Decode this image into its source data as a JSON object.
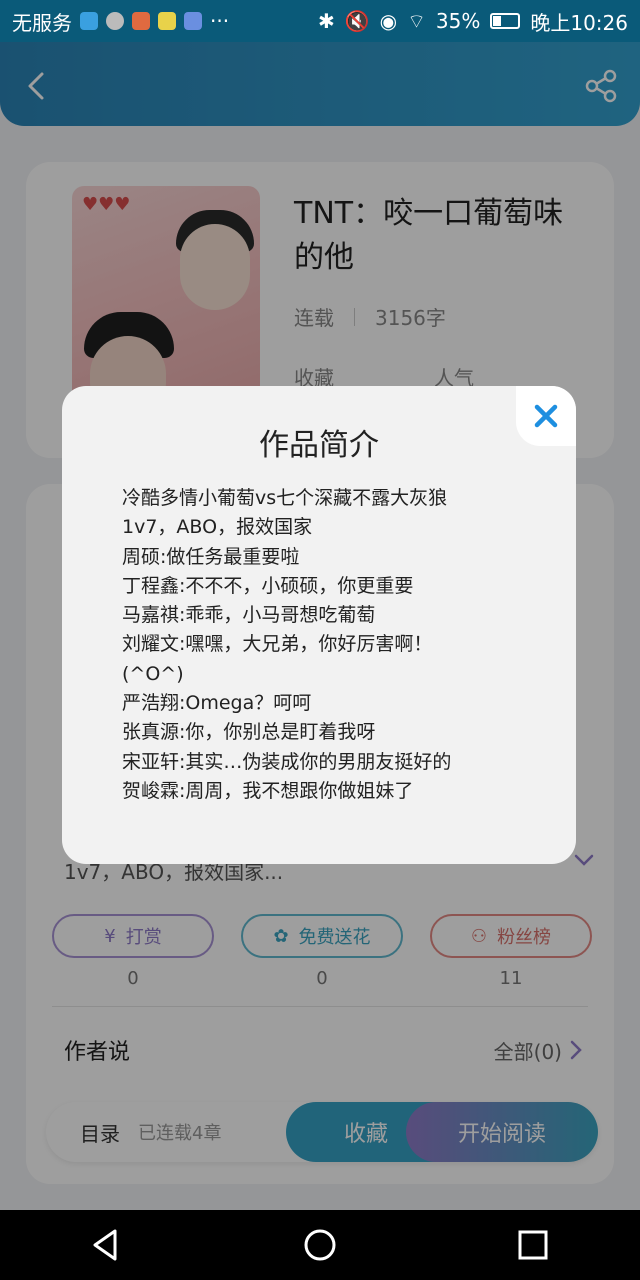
{
  "status_bar": {
    "carrier": "无服务",
    "battery": "35%",
    "battery_level": 0.35,
    "time": "晚上10:26"
  },
  "book": {
    "title": "TNT：咬一口葡萄味的他",
    "status": "连载",
    "word_count": "3156字",
    "collect_label": "收藏",
    "popularity_label": "人气"
  },
  "detail": {
    "intro_preview": "1v7，ABO，报效国家...",
    "actions": [
      {
        "label": "打赏",
        "icon": "coin-icon",
        "count": "0"
      },
      {
        "label": "免费送花",
        "icon": "flower-icon",
        "count": "0"
      },
      {
        "label": "粉丝榜",
        "icon": "user-icon",
        "count": "11"
      }
    ],
    "author_section": {
      "title": "作者说",
      "all_label": "全部(0)"
    }
  },
  "bottom_bar": {
    "toc_label": "目录",
    "toc_count": "已连载4章",
    "collect_button": "收藏",
    "read_button": "开始阅读"
  },
  "modal": {
    "title": "作品简介",
    "lines": [
      "冷酷多情小葡萄vs七个深藏不露大灰狼",
      "1v7，ABO，报效国家",
      "周硕:做任务最重要啦",
      "丁程鑫:不不不，小硕硕，你更重要",
      "马嘉祺:乖乖，小马哥想吃葡萄",
      "刘耀文:嘿嘿，大兄弟，你好厉害啊！",
      "(^O^)",
      "严浩翔:Omega？呵呵",
      "张真源:你，你别总是盯着我呀",
      "宋亚轩:其实…伪装成你的男朋友挺好的",
      "贺峻霖:周周，我不想跟你做姐妹了"
    ]
  },
  "colors": {
    "header": "#2b84b6",
    "accent": "#36a2c6",
    "close_icon": "#1e8fe0"
  }
}
